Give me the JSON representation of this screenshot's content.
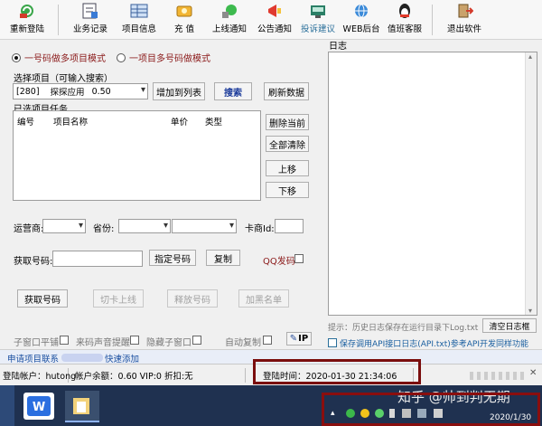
{
  "toolbar": {
    "items": [
      {
        "label": "重新登陆",
        "icon": "relogin-icon"
      },
      {
        "label": "业务记录",
        "icon": "record-icon"
      },
      {
        "label": "项目信息",
        "icon": "project-info-icon"
      },
      {
        "label": "充 值",
        "icon": "recharge-icon"
      },
      {
        "label": "上线通知",
        "icon": "online-notice-icon"
      },
      {
        "label": "公告通知",
        "icon": "announcement-icon"
      },
      {
        "label": "投诉建议",
        "icon": "feedback-icon"
      },
      {
        "label": "WEB后台",
        "icon": "web-admin-icon"
      },
      {
        "label": "值班客服",
        "icon": "customer-service-icon"
      },
      {
        "label": "退出软件",
        "icon": "exit-icon"
      }
    ]
  },
  "mode": {
    "option1": "一号码做多项目模式",
    "option2": "一项目多号码做模式",
    "selected": "option1"
  },
  "project": {
    "label": "选择项目（可输入搜索）",
    "selected_id": "[280]",
    "selected_name": "探探应用",
    "selected_price": "0.50",
    "add_button": "增加到列表",
    "search_button": "搜索",
    "refresh_button": "刷新数据"
  },
  "tasks": {
    "label": "已选项目任务",
    "columns": [
      "编号",
      "项目名称",
      "单价",
      "类型"
    ],
    "rows": [],
    "delete_current": "删除当前",
    "clear_all": "全部清除",
    "move_up": "上移",
    "move_down": "下移"
  },
  "filters": {
    "carrier_label": "运营商:",
    "province_label": "省份:",
    "card_vendor_label": "卡商Id:"
  },
  "number": {
    "label": "获取号码:",
    "value": "",
    "specify_button": "指定号码",
    "copy_button": "复制",
    "qq_label": "QQ发码"
  },
  "actions": {
    "get_number": "获取号码",
    "switch_online": "切卡上线",
    "release_number": "释放号码",
    "blacklist": "加黑名单"
  },
  "options": {
    "sub_window_tile": "子窗口平铺",
    "incoming_sound": "来码声音提醒",
    "hide_sub_window": "隐藏子窗口",
    "auto_copy": "自动复制",
    "ip_badge": "IP"
  },
  "log": {
    "title": "日志",
    "hint": "提示：历史日志保存在运行目录下Log.txt",
    "clear_button": "清空日志框",
    "save_api_label": "保存调用API接口日志(API.txt)参考API开发同样功能"
  },
  "apply_bar": {
    "text_left": "申请项目联系",
    "text_right": "快速添加"
  },
  "status": {
    "account": "登陆帐户：hutong",
    "balance": "帐户余额：0.60  VIP:0 折扣:无",
    "login_time": "登陆时间：2020-01-30 21:34:06"
  },
  "taskbar": {
    "watermark": "知乎 @帅到判无期",
    "date": "2020/1/30"
  },
  "colors": {
    "highlight_border": "#7a0d0d",
    "taskbar_bg": "#1f3150",
    "radio_text": "#8b1a1a"
  }
}
